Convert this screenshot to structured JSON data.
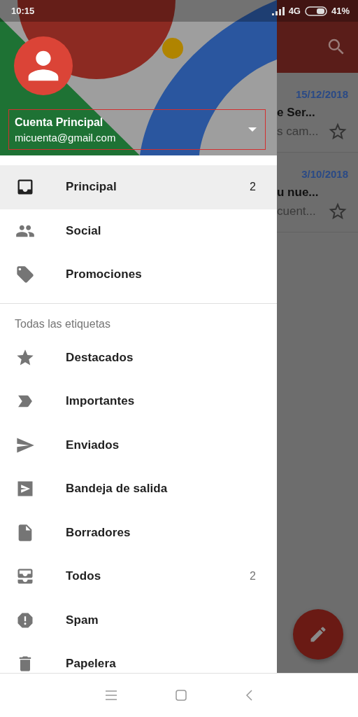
{
  "status_bar": {
    "time": "10:15",
    "network": "4G",
    "battery": "41%"
  },
  "account": {
    "name": "Cuenta Principal",
    "email": "micuenta@gmail.com"
  },
  "primary": [
    {
      "label": "Principal",
      "count": "2",
      "selected": true
    },
    {
      "label": "Social",
      "selected": false
    },
    {
      "label": "Promociones",
      "selected": false
    }
  ],
  "labels_header": "Todas las etiquetas",
  "labels": [
    {
      "label": "Destacados",
      "selected": false
    },
    {
      "label": "Importantes",
      "selected": false
    },
    {
      "label": "Enviados",
      "selected": false
    },
    {
      "label": "Bandeja de salida",
      "selected": false
    },
    {
      "label": "Borradores",
      "selected": false
    },
    {
      "label": "Todos",
      "count": "2",
      "selected": false
    },
    {
      "label": "Spam",
      "selected": false
    },
    {
      "label": "Papelera",
      "selected": false
    }
  ],
  "emails": [
    {
      "date": "15/12/2018",
      "subject": "e Ser...",
      "preview": "s cam..."
    },
    {
      "date": "3/10/2018",
      "subject": "u nue...",
      "preview": "cuent..."
    }
  ]
}
